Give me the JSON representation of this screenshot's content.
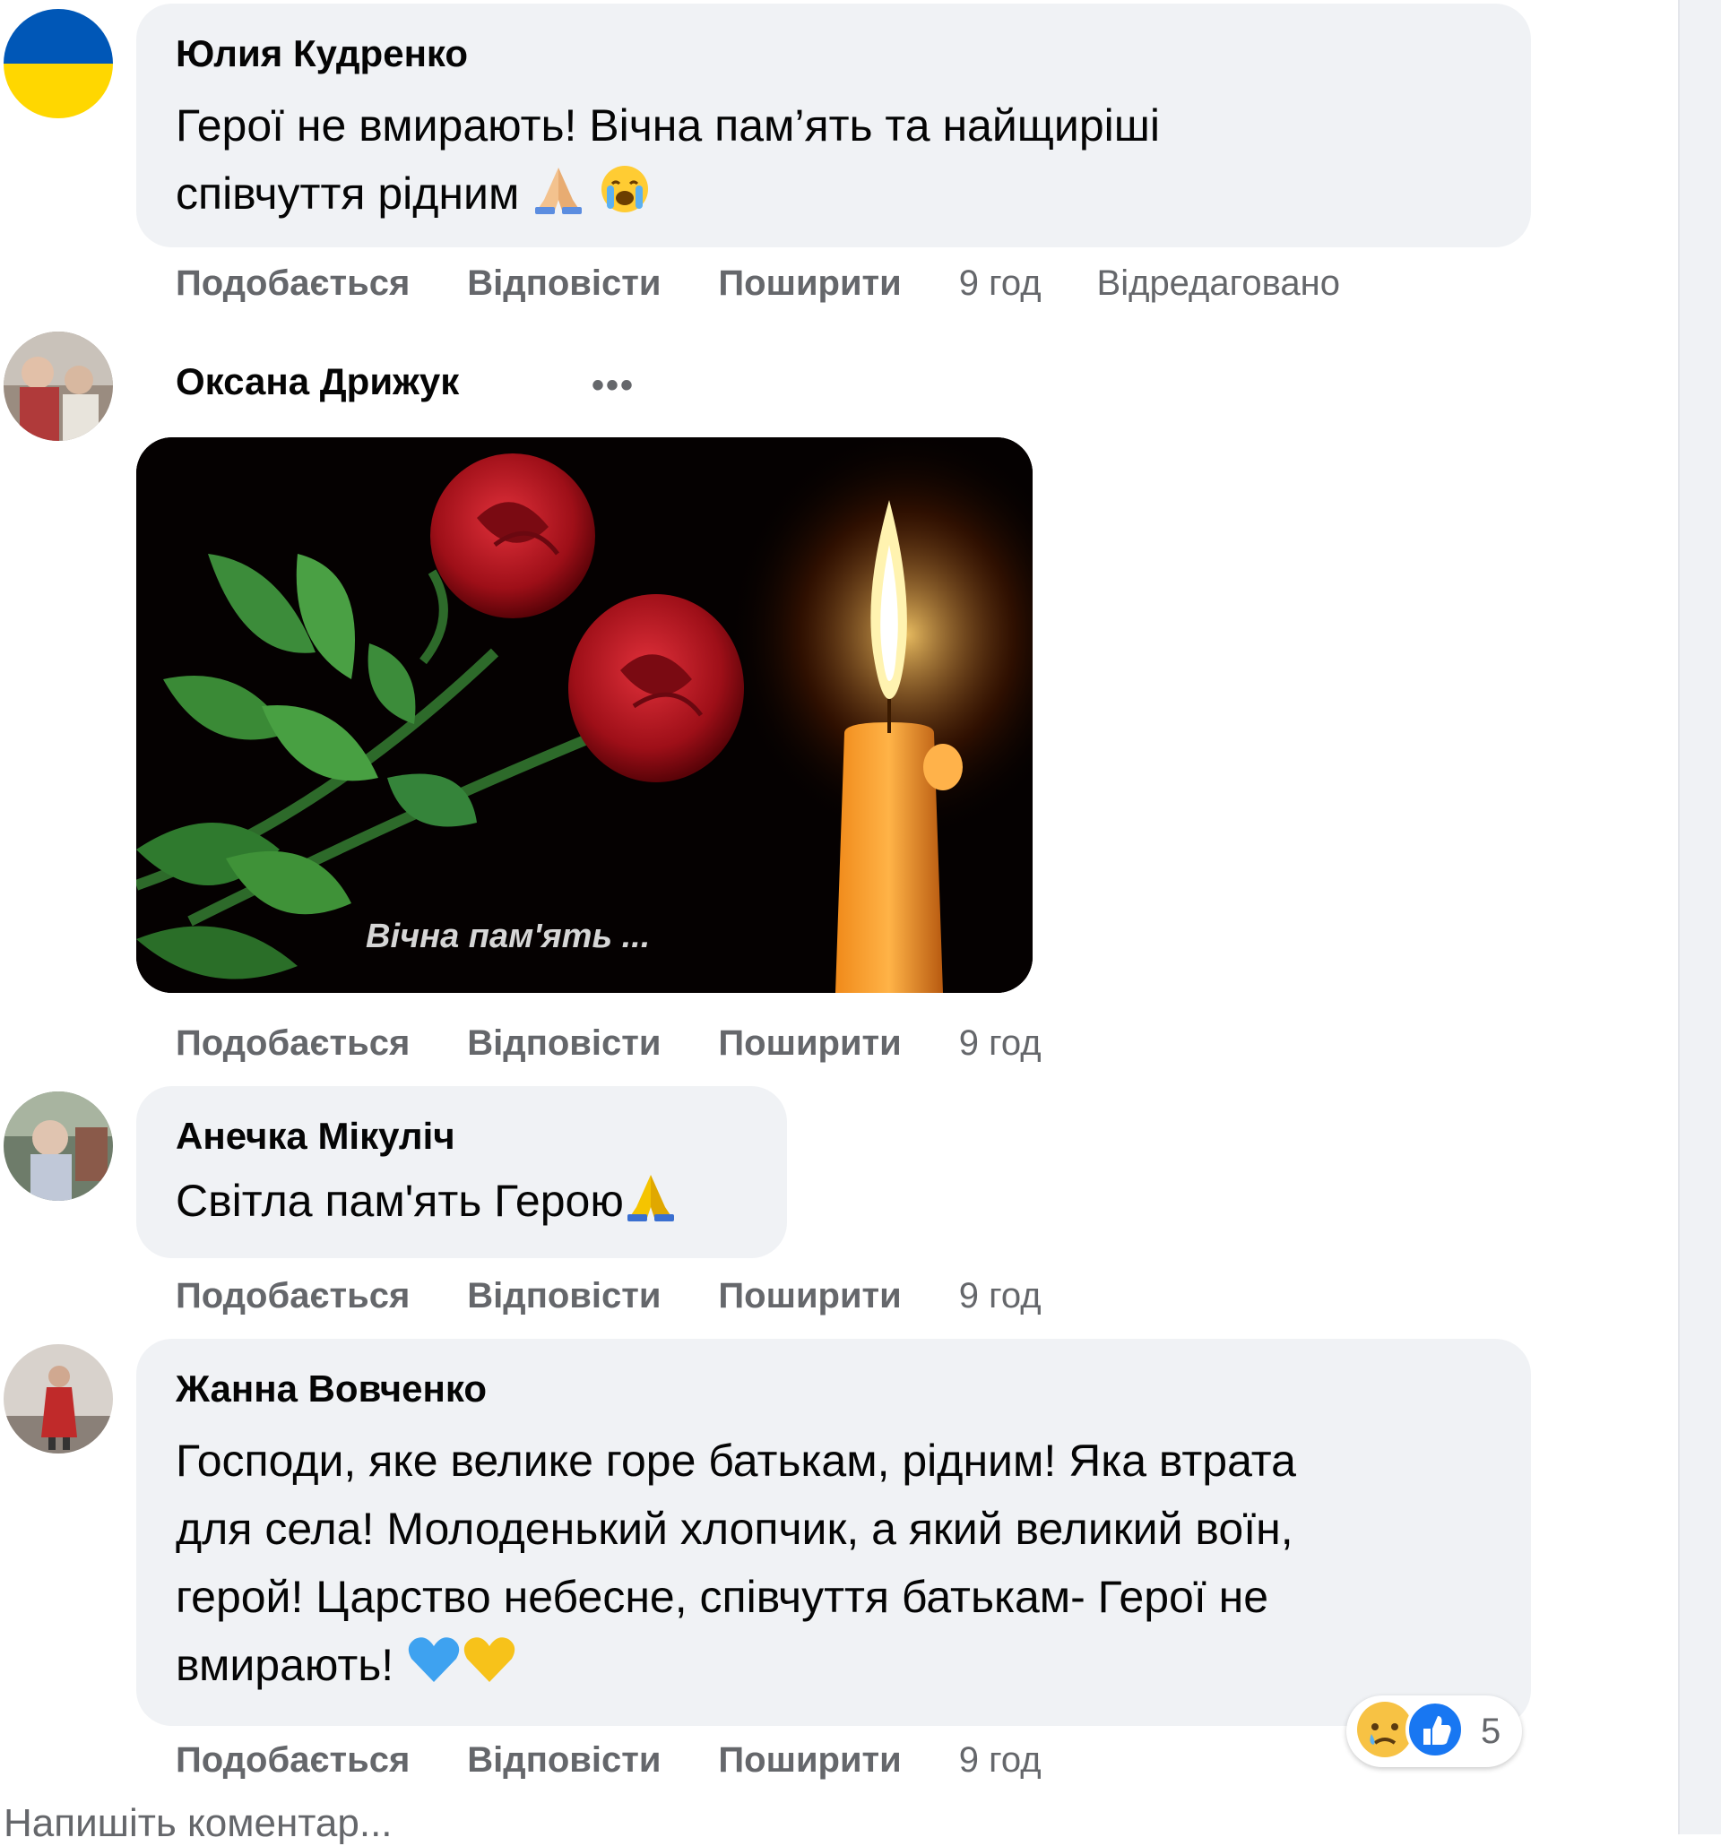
{
  "comments": [
    {
      "author": "Юлия Кудренко",
      "text_line1": "Герої не вмирають! Вічна пам’ять та найщиріші",
      "text_line2": "співчуття рідним",
      "like": "Подобається",
      "reply": "Відповісти",
      "share": "Поширити",
      "time": "9 год",
      "edited": "Відредаговано"
    },
    {
      "author": "Оксана Дрижук",
      "more": "•••",
      "image_caption": "Вічна пам'ять ...",
      "like": "Подобається",
      "reply": "Відповісти",
      "share": "Поширити",
      "time": "9 год"
    },
    {
      "author": "Анечка Мікуліч",
      "text": "Світла пам'ять Герою",
      "like": "Подобається",
      "reply": "Відповісти",
      "share": "Поширити",
      "time": "9 год"
    },
    {
      "author": "Жанна Вовченко",
      "text_line1": "Господи, яке велике горе батькам, рідним! Яка втрата",
      "text_line2": "для села! Молоденький хлопчик, а який великий воїн,",
      "text_line3": "герой! Царство небесне, співчуття батькам- Герої не",
      "text_line4": "вмирають!",
      "reactions_count": "5",
      "like": "Подобається",
      "reply": "Відповісти",
      "share": "Поширити",
      "time": "9 год"
    }
  ],
  "write_comment_placeholder": "Напишіть коментар...",
  "icons": [
    "ukraine-flag-avatar",
    "pray-emoji",
    "crying-emoji",
    "blue-heart-emoji",
    "yellow-heart-emoji",
    "sad-reaction-icon",
    "like-reaction-icon",
    "more-options-icon"
  ],
  "colors": {
    "bubble": "#f0f2f5",
    "meta_text": "#65676b",
    "primary_text": "#050505",
    "flag_blue": "#0057b7",
    "flag_yellow": "#ffd700"
  }
}
